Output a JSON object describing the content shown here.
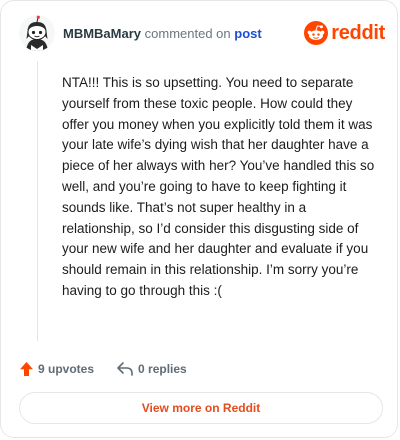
{
  "header": {
    "username": "MBMBaMary",
    "verb": "commented on",
    "post_link": "post",
    "brand": "reddit",
    "avatar": "snoo-avatar",
    "logo_icon": "reddit-alien-icon"
  },
  "comment": {
    "text": "NTA!!! This is so upsetting. You need to separate yourself from these toxic people. How could they offer you money when you explicitly told them it was your late wife’s dying wish that her daughter have a piece of her always with her? You’ve handled this so well, and you’re going to have to keep fighting it sounds like. That’s not super healthy in a relationship, so I’d consider this disgusting side of your new wife and her daughter and evaluate if you should remain in this relationship. I’m sorry you’re having to go through this :("
  },
  "actions": {
    "upvotes": "9 upvotes",
    "replies": "0 replies",
    "upvote_icon": "upvote-arrow-icon",
    "reply_icon": "reply-arrow-icon"
  },
  "footer": {
    "view_more": "View more on Reddit"
  },
  "colors": {
    "brand_orange": "#ff4500",
    "link_blue": "#1d4ed8",
    "view_more_text": "#e34c1c"
  }
}
